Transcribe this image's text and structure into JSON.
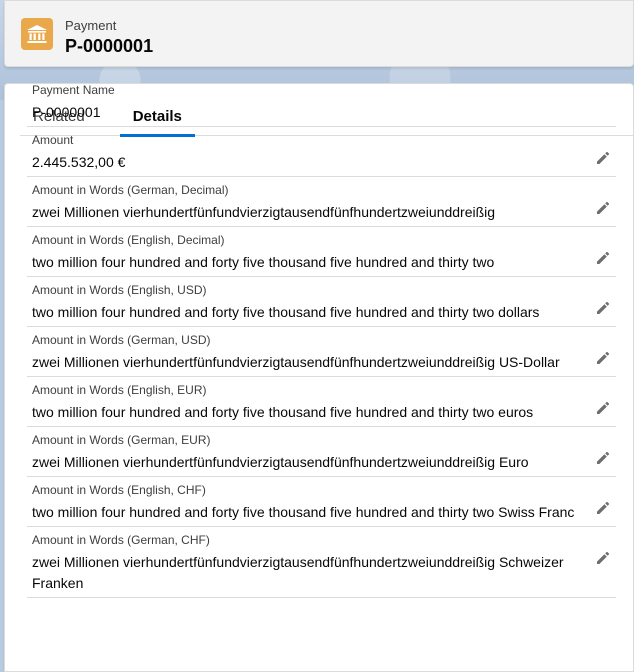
{
  "header": {
    "object_label": "Payment",
    "record_title": "P-0000001",
    "icon": "bank-icon",
    "accent_color": "#e9a94b"
  },
  "tabs": [
    {
      "label": "Related",
      "active": false
    },
    {
      "label": "Details",
      "active": true
    }
  ],
  "fields": [
    {
      "label": "Payment Name",
      "value": "P-0000001",
      "editable": false
    },
    {
      "label": "Amount",
      "value": "2.445.532,00 €",
      "editable": true
    },
    {
      "label": "Amount in Words (German, Decimal)",
      "value": "zwei Millionen vierhundertfünfundvierzigtausendfünfhundertzweiunddreißig",
      "editable": true
    },
    {
      "label": "Amount in Words (English, Decimal)",
      "value": "two million four hundred and forty five thousand five hundred and thirty two",
      "editable": true
    },
    {
      "label": "Amount in Words (English, USD)",
      "value": "two million four hundred and forty five thousand five hundred and thirty two dollars",
      "editable": true
    },
    {
      "label": "Amount in Words (German, USD)",
      "value": "zwei Millionen vierhundertfünfundvierzigtausendfünfhundertzweiunddreißig US-Dollar",
      "editable": true
    },
    {
      "label": "Amount in Words (English, EUR)",
      "value": "two million four hundred and forty five thousand five hundred and thirty two euros",
      "editable": true
    },
    {
      "label": "Amount in Words (German, EUR)",
      "value": "zwei Millionen vierhundertfünfundvierzigtausendfünfhundertzweiunddreißig Euro",
      "editable": true
    },
    {
      "label": "Amount in Words (English, CHF)",
      "value": "two million four hundred and forty five thousand five hundred and thirty two Swiss Franc",
      "editable": true
    },
    {
      "label": "Amount in Words (German, CHF)",
      "value": "zwei Millionen vierhundertfünfundvierzigtausendfünfhundertzweiunddreißig Schweizer Franken",
      "editable": true
    }
  ]
}
